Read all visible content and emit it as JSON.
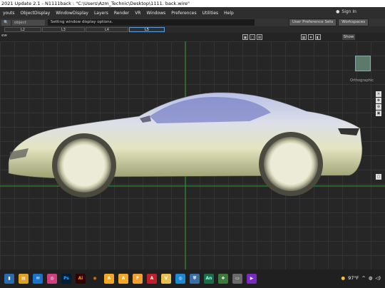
{
  "window": {
    "title": "2021 Update 2.1   - N1111back : \"C:\\Users\\Azm_Technic\\Desktop\\1111. back.wire\""
  },
  "menu": [
    "youts",
    "ObjectDisplay",
    "WindowDisplay",
    "Layers",
    "Render",
    "VR",
    "Windows",
    "Preferences",
    "Utilities",
    "Help"
  ],
  "signin": "Sign In",
  "toolbar": {
    "search_value": "object",
    "hint": "Setting window display options.",
    "user_pref": "User Preference Sets",
    "workspaces": "Workspaces"
  },
  "layers": [
    "L2",
    "L3",
    "L4",
    "L5"
  ],
  "viewport": {
    "label": "ew",
    "show": "Show",
    "view_name": "Orthographic"
  },
  "taskbar": {
    "temperature": "97°F"
  },
  "colors": {
    "grid_green": "#2ea02e",
    "accent_blue": "#5aa0e0"
  }
}
